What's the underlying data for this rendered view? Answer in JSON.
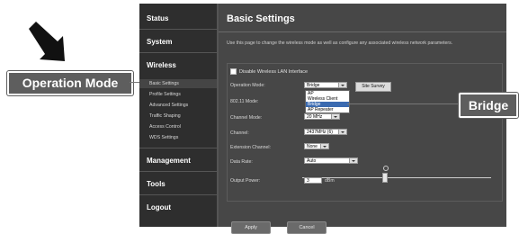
{
  "annotations": {
    "left_callout": "Operation Mode",
    "right_callout": "Bridge"
  },
  "sidebar": {
    "sections": [
      "Status",
      "System",
      "Wireless",
      "Management",
      "Tools",
      "Logout"
    ],
    "wireless_subitems": [
      "Basic Settings",
      "Profile Settings",
      "Advanced Settings",
      "Traffic Shaping",
      "Access Control",
      "WDS Settings"
    ]
  },
  "main": {
    "title": "Basic Settings",
    "description": "Use this page to change the wireless mode as well as configure any associated wireless network parameters.",
    "disable_checkbox_label": "Disable Wireless LAN Interface",
    "fields": {
      "operation_mode": {
        "label": "Operation Mode:",
        "value": "Bridge",
        "site_survey": "Site Survey"
      },
      "mode_80211": {
        "label": "802.11 Mode:"
      },
      "channel_mode": {
        "label": "Channel Mode:",
        "value": "20 MHz"
      },
      "channel": {
        "label": "Channel:",
        "value": "2437MHz (6)"
      },
      "extension_channel": {
        "label": "Extension Channel:",
        "value": "None"
      },
      "data_rate": {
        "label": "Data Rate:",
        "value": "Auto"
      },
      "output_power": {
        "label": "Output Power:",
        "value": "3",
        "unit": "dBm"
      }
    },
    "dropdown_options": [
      "AP",
      "Wireless Client",
      "Bridge",
      "AP Repeater"
    ],
    "dropdown_selected": "Bridge",
    "buttons": {
      "apply": "Apply",
      "cancel": "Cancel"
    }
  }
}
